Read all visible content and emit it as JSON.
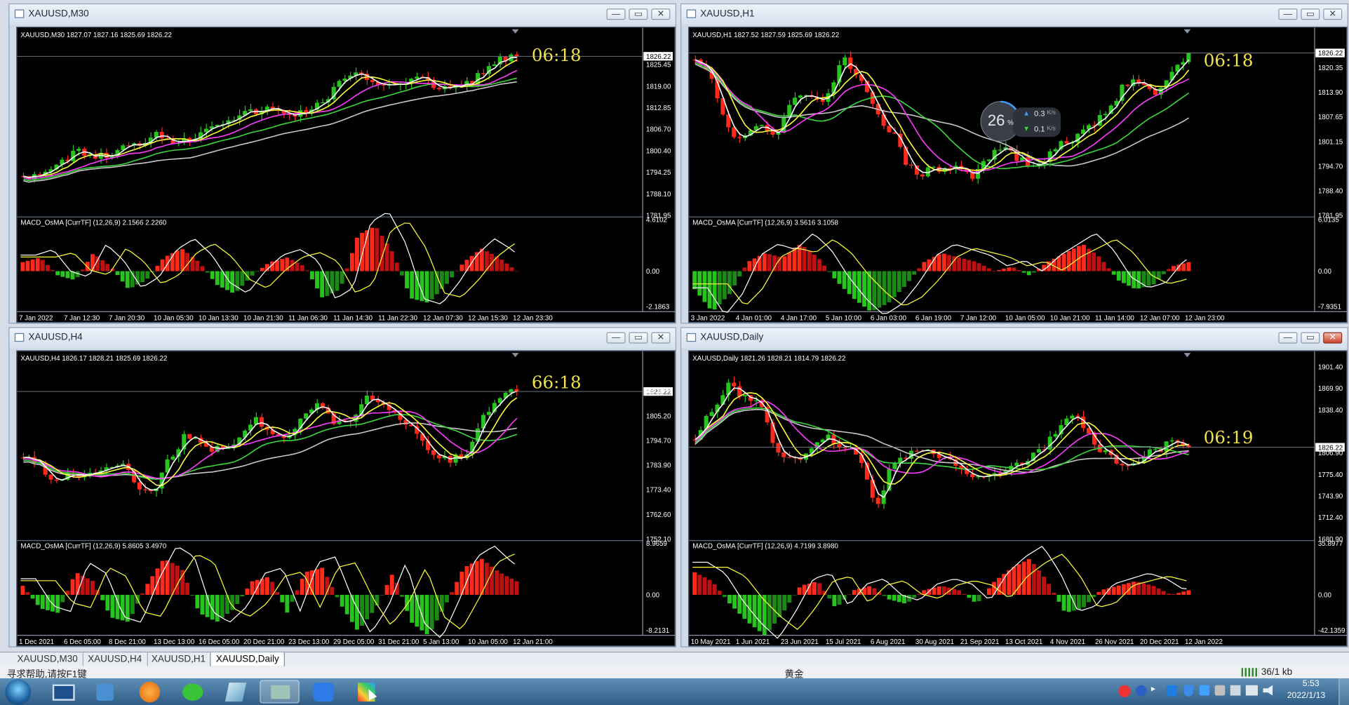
{
  "windows": [
    {
      "id": "m30",
      "title": "XAUUSD,M30",
      "ohlc": "XAUUSD,M30  1827.07 1827.16 1825.69 1826.22",
      "price_labels": [
        "1826.22",
        "1825.45",
        "1819.00",
        "1812.85",
        "1806.70",
        "1800.40",
        "1794.25",
        "1788.10",
        "1781.95"
      ],
      "current_price": "1826.22",
      "macd_label": "MACD_OsMA [CurrTF] (12,26,9) 2.1566 2.2260",
      "macd_labels": [
        "4.6102",
        "0.00",
        "-2.1863"
      ],
      "time_labels": [
        "7 Jan 2022",
        "7 Jan 12:30",
        "7 Jan 20:30",
        "10 Jan 05:30",
        "10 Jan 13:30",
        "10 Jan 21:30",
        "11 Jan 06:30",
        "11 Jan 14:30",
        "11 Jan 22:30",
        "12 Jan 07:30",
        "12 Jan 15:30",
        "12 Jan 23:30"
      ],
      "clock": "06:18",
      "buttons": [
        "—",
        "▭",
        "✕"
      ]
    },
    {
      "id": "h1",
      "title": "XAUUSD,H1",
      "ohlc": "XAUUSD,H1  1827.52 1827.59 1825.69 1826.22",
      "price_labels": [
        "1826.22",
        "1820.35",
        "1813.90",
        "1807.65",
        "1801.15",
        "1794.70",
        "1788.40",
        "1781.95"
      ],
      "current_price": "1826.22",
      "macd_label": "MACD_OsMA [CurrTF] (12,26,9) 3.5616 3.1058",
      "macd_labels": [
        "6.0135",
        "0.00",
        "-7.9351"
      ],
      "time_labels": [
        "3 Jan 2022",
        "4 Jan 01:00",
        "4 Jan 17:00",
        "5 Jan 10:00",
        "6 Jan 03:00",
        "6 Jan 19:00",
        "7 Jan 12:00",
        "10 Jan 05:00",
        "10 Jan 21:00",
        "11 Jan 14:00",
        "12 Jan 07:00",
        "12 Jan 23:00"
      ],
      "clock": "06:18",
      "buttons": [
        "—",
        "▭",
        "✕"
      ]
    },
    {
      "id": "h4",
      "title": "XAUUSD,H4",
      "ohlc": "XAUUSD,H4  1826.17 1828.21 1825.69 1826.22",
      "price_labels": [
        "1826.22",
        "1816.00",
        "1805.20",
        "1794.70",
        "1783.90",
        "1773.40",
        "1762.60",
        "1752.10"
      ],
      "current_price": "1826.22",
      "macd_label": "MACD_OsMA [CurrTF] (12,26,9) 5.8605 3.4970",
      "macd_labels": [
        "8.9659",
        "0.00",
        "-8.2131"
      ],
      "time_labels": [
        "1 Dec 2021",
        "6 Dec 05:00",
        "8 Dec 21:00",
        "13 Dec 13:00",
        "16 Dec 05:00",
        "20 Dec 21:00",
        "23 Dec 13:00",
        "29 Dec 05:00",
        "31 Dec 21:00",
        "5 Jan 13:00",
        "10 Jan 05:00",
        "12 Jan 21:00"
      ],
      "clock": "66:18",
      "buttons": [
        "—",
        "▭",
        "✕"
      ]
    },
    {
      "id": "d1",
      "title": "XAUUSD,Daily",
      "ohlc": "XAUUSD,Daily  1821.26 1828.21 1814.79 1826.22",
      "price_labels": [
        "1901.40",
        "1869.90",
        "1838.40",
        "1826.22",
        "1806.90",
        "1775.40",
        "1743.90",
        "1712.40",
        "1680.90"
      ],
      "current_price": "1826.22",
      "macd_label": "MACD_OsMA [CurrTF] (12,26,9) 4.7199 3.8980",
      "macd_labels": [
        "35.8977",
        "0.00",
        "-42.1359"
      ],
      "time_labels": [
        "10 May 2021",
        "1 Jun 2021",
        "23 Jun 2021",
        "15 Jul 2021",
        "6 Aug 2021",
        "30 Aug 2021",
        "21 Sep 2021",
        "13 Oct 2021",
        "4 Nov 2021",
        "26 Nov 2021",
        "20 Dec 2021",
        "12 Jan 2022"
      ],
      "clock": "06:19",
      "buttons": [
        "—",
        "▭",
        "✕"
      ]
    }
  ],
  "tabs": [
    "XAUUSD,M30",
    "XAUUSD,H4",
    "XAUUSD,H1",
    "XAUUSD,Daily"
  ],
  "active_tab": "XAUUSD,Daily",
  "status": {
    "help": "寻求帮助,请按F1键",
    "profile": "黄金",
    "traffic": "36/1 kb"
  },
  "network_widget": {
    "percent": "26",
    "percent_unit": "%",
    "up": "0.3",
    "down": "0.1",
    "rate_unit": "K/s"
  },
  "taskbar": {
    "time": "5:53",
    "date": "2022/1/13",
    "icons": [
      "start-orb-icon",
      "desktop-icon",
      "contacts-icon",
      "browser-icon",
      "wechat-icon",
      "notebook-icon",
      "trading-app-icon",
      "feishu-icon",
      "paint-icon"
    ]
  },
  "colors": {
    "bull": "#27c41d",
    "bear": "#ff2a1a",
    "ma_fast": "#ffffff",
    "ma_yellow": "#ffff3a",
    "ma_magenta": "#ff3cff",
    "ma_green": "#3cd83c",
    "ma_gray": "#c8c8c8",
    "clock": "#f0e24a"
  }
}
